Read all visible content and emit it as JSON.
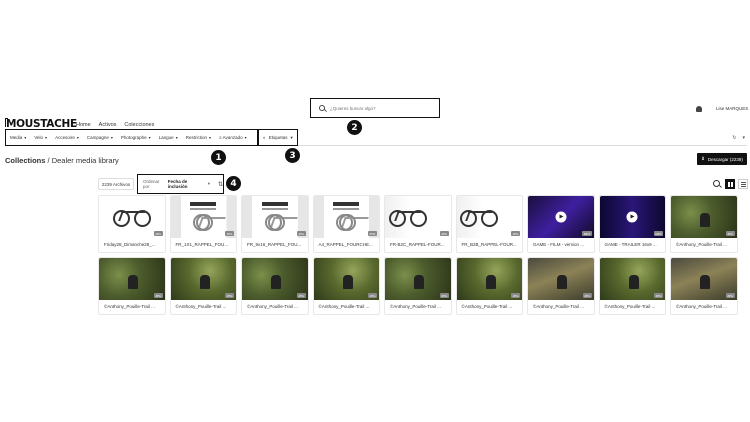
{
  "header": {
    "search_placeholder": "¿Quieres buscar algo?",
    "user_name": "Lise MARQUES",
    "logo": "MOUSTACHE",
    "nav": [
      "Home",
      "Activos",
      "Colecciones"
    ]
  },
  "filters": {
    "items": [
      "Media",
      "Velo",
      "Accesoire",
      "Campagne",
      "Photographe",
      "Langue",
      "Restriction",
      "Avanzado"
    ],
    "tags_label": "Etiquetas"
  },
  "markers": [
    "1",
    "2",
    "3",
    "4"
  ],
  "page": {
    "breadcrumb_root": "Collections",
    "breadcrumb_separator": " / ",
    "title": "Dealer media library",
    "download_label": "Descargar (2239)"
  },
  "toolbar": {
    "file_count": "2239 Archivos",
    "sort_prefix": "Ordenar por",
    "sort_value": "Fecha de inclusión"
  },
  "assets": [
    {
      "title": "Friday28_Dimanche28_...",
      "badge": "JPG",
      "thumb": "bike-white"
    },
    {
      "title": "FR_1X1_RAPPEL_FOURC...",
      "badge": "JPG",
      "thumb": "poster"
    },
    {
      "title": "FR_9x16_RAPPEL_FOU...",
      "badge": "JPG",
      "thumb": "poster"
    },
    {
      "title": "A4_RAPPEL_FOURCHE...",
      "badge": "PDF",
      "thumb": "poster"
    },
    {
      "title": "FR-B2C_RAPPEL-FOUR...",
      "badge": "JPG",
      "thumb": "poster-wide"
    },
    {
      "title": "FR_B2B_RAPPEL-FOUR...",
      "badge": "JPG",
      "thumb": "poster-wide"
    },
    {
      "title": "GAME - FILM - version ...",
      "badge": "MP4",
      "thumb": "video"
    },
    {
      "title": "GAME - TRAILER 16x9 ...",
      "badge": "MP4",
      "thumb": "video2"
    },
    {
      "title": "©Anthony_Pouille-Trail ...",
      "badge": "JPG",
      "thumb": "forest"
    },
    {
      "title": "©Anthony_Pouille-Trail ...",
      "badge": "JPG",
      "thumb": "forest"
    },
    {
      "title": "©Anthony_Pouille-Trail ...",
      "badge": "JPG",
      "thumb": "forest2"
    },
    {
      "title": "©Anthony_Pouille-Trail ...",
      "badge": "JPG",
      "thumb": "forest"
    },
    {
      "title": "©Anthony_Pouille-Trail ...",
      "badge": "JPG",
      "thumb": "forest2"
    },
    {
      "title": "©Anthony_Pouille-Trail ...",
      "badge": "JPG",
      "thumb": "forest"
    },
    {
      "title": "©Anthony_Pouille-Trail ...",
      "badge": "JPG",
      "thumb": "forest2"
    },
    {
      "title": "©Anthony_Pouille-Trail ...",
      "badge": "JPG",
      "thumb": "forest3"
    },
    {
      "title": "©Anthony_Pouille-Trail ...",
      "badge": "JPG",
      "thumb": "forest2"
    },
    {
      "title": "©Anthony_Pouille-Trail ...",
      "badge": "JPG",
      "thumb": "forest3"
    }
  ]
}
